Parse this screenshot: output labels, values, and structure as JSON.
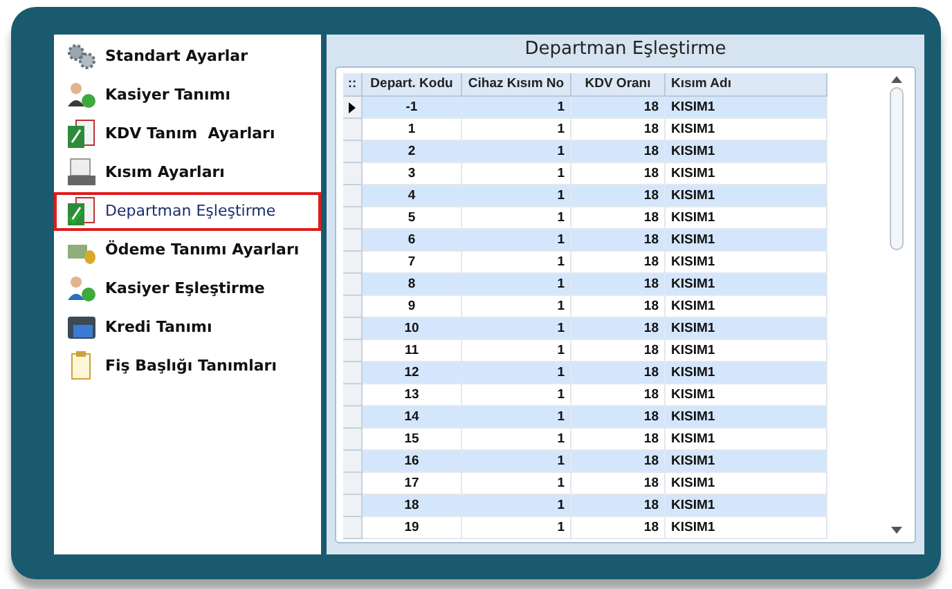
{
  "sidebar": {
    "items": [
      {
        "label": "Standart Ayarlar",
        "selected": false
      },
      {
        "label": "Kasiyer Tanımı",
        "selected": false
      },
      {
        "label": "KDV Tanım  Ayarları",
        "selected": false
      },
      {
        "label": "Kısım Ayarları",
        "selected": false
      },
      {
        "label": "Departman Eşleştirme",
        "selected": true
      },
      {
        "label": "Ödeme Tanımı Ayarları",
        "selected": false
      },
      {
        "label": "Kasiyer Eşleştirme",
        "selected": false
      },
      {
        "label": "Kredi Tanımı",
        "selected": false
      },
      {
        "label": "Fiş Başlığı Tanımları",
        "selected": false
      }
    ]
  },
  "panel": {
    "title": "Departman Eşleştirme",
    "table": {
      "corner": "::",
      "columns": [
        "Depart. Kodu",
        "Cihaz Kısım No",
        "KDV Oranı",
        "Kısım Adı"
      ],
      "rows": [
        {
          "current": true,
          "cells": [
            "-1",
            "1",
            "18",
            "KISIM1"
          ]
        },
        {
          "current": false,
          "cells": [
            "1",
            "1",
            "18",
            "KISIM1"
          ]
        },
        {
          "current": false,
          "cells": [
            "2",
            "1",
            "18",
            "KISIM1"
          ]
        },
        {
          "current": false,
          "cells": [
            "3",
            "1",
            "18",
            "KISIM1"
          ]
        },
        {
          "current": false,
          "cells": [
            "4",
            "1",
            "18",
            "KISIM1"
          ]
        },
        {
          "current": false,
          "cells": [
            "5",
            "1",
            "18",
            "KISIM1"
          ]
        },
        {
          "current": false,
          "cells": [
            "6",
            "1",
            "18",
            "KISIM1"
          ]
        },
        {
          "current": false,
          "cells": [
            "7",
            "1",
            "18",
            "KISIM1"
          ]
        },
        {
          "current": false,
          "cells": [
            "8",
            "1",
            "18",
            "KISIM1"
          ]
        },
        {
          "current": false,
          "cells": [
            "9",
            "1",
            "18",
            "KISIM1"
          ]
        },
        {
          "current": false,
          "cells": [
            "10",
            "1",
            "18",
            "KISIM1"
          ]
        },
        {
          "current": false,
          "cells": [
            "11",
            "1",
            "18",
            "KISIM1"
          ]
        },
        {
          "current": false,
          "cells": [
            "12",
            "1",
            "18",
            "KISIM1"
          ]
        },
        {
          "current": false,
          "cells": [
            "13",
            "1",
            "18",
            "KISIM1"
          ]
        },
        {
          "current": false,
          "cells": [
            "14",
            "1",
            "18",
            "KISIM1"
          ]
        },
        {
          "current": false,
          "cells": [
            "15",
            "1",
            "18",
            "KISIM1"
          ]
        },
        {
          "current": false,
          "cells": [
            "16",
            "1",
            "18",
            "KISIM1"
          ]
        },
        {
          "current": false,
          "cells": [
            "17",
            "1",
            "18",
            "KISIM1"
          ]
        },
        {
          "current": false,
          "cells": [
            "18",
            "1",
            "18",
            "KISIM1"
          ]
        },
        {
          "current": false,
          "cells": [
            "19",
            "1",
            "18",
            "KISIM1"
          ]
        }
      ]
    }
  }
}
